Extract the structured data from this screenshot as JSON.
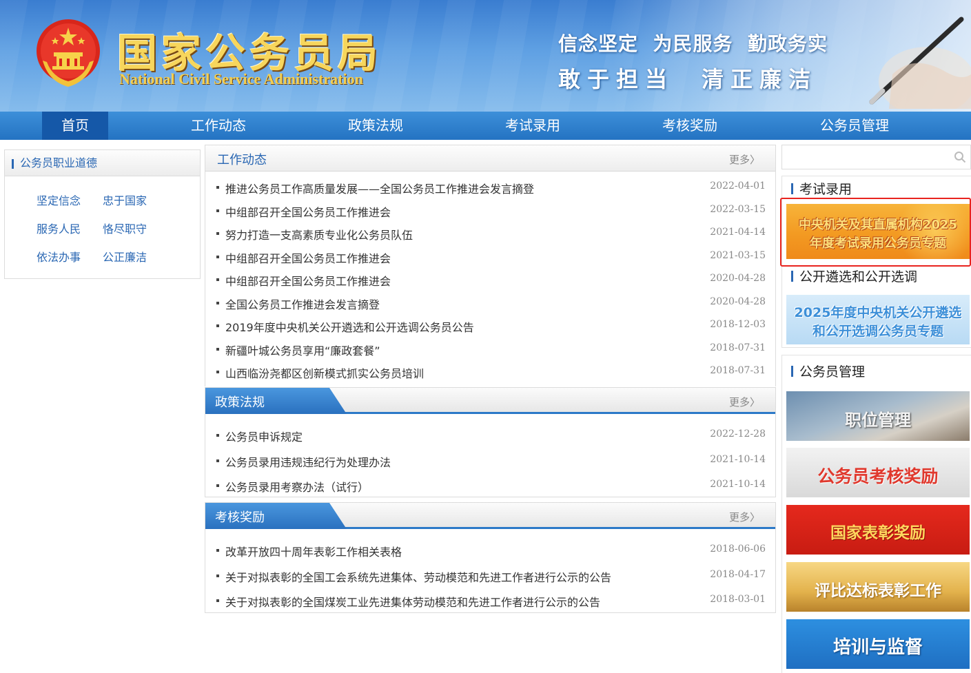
{
  "header": {
    "title_cn": "国家公务员局",
    "title_en": "National Civil Service Administration",
    "slogan_line1": "信念坚定  为民服务  勤政务实",
    "slogan_line2_a": "敢于担当",
    "slogan_line2_b": "清正廉洁"
  },
  "nav": {
    "items": [
      "首页",
      "工作动态",
      "政策法规",
      "考试录用",
      "考核奖励",
      "公务员管理"
    ],
    "active": "首页"
  },
  "left": {
    "title": "公务员职业道德",
    "items": [
      "坚定信念",
      "忠于国家",
      "服务人民",
      "恪尽职守",
      "依法办事",
      "公正廉洁"
    ]
  },
  "panels": {
    "work": {
      "title": "工作动态",
      "more": "更多〉",
      "rows": [
        {
          "text": "推进公务员工作高质量发展——全国公务员工作推进会发言摘登",
          "date": "2022-04-01"
        },
        {
          "text": "中组部召开全国公务员工作推进会",
          "date": "2022-03-15"
        },
        {
          "text": "努力打造一支高素质专业化公务员队伍",
          "date": "2021-04-14"
        },
        {
          "text": "中组部召开全国公务员工作推进会",
          "date": "2021-03-15"
        },
        {
          "text": "中组部召开全国公务员工作推进会",
          "date": "2020-04-28"
        },
        {
          "text": "全国公务员工作推进会发言摘登",
          "date": "2020-04-28"
        },
        {
          "text": "2019年度中央机关公开遴选和公开选调公务员公告",
          "date": "2018-12-03"
        },
        {
          "text": "新疆叶城公务员享用“廉政套餐”",
          "date": "2018-07-31"
        },
        {
          "text": "山西临汾尧都区创新模式抓实公务员培训",
          "date": "2018-07-31"
        }
      ]
    },
    "policy": {
      "title": "政策法规",
      "more": "更多〉",
      "rows": [
        {
          "text": "公务员申诉规定",
          "date": "2022-12-28"
        },
        {
          "text": "公务员录用违规违纪行为处理办法",
          "date": "2021-10-14"
        },
        {
          "text": "公务员录用考察办法（试行）",
          "date": "2021-10-14"
        }
      ]
    },
    "reward": {
      "title": "考核奖励",
      "more": "更多〉",
      "rows": [
        {
          "text": "改革开放四十周年表彰工作相关表格",
          "date": "2018-06-06"
        },
        {
          "text": "关于对拟表彰的全国工会系统先进集体、劳动模范和先进工作者进行公示的公告",
          "date": "2018-04-17"
        },
        {
          "text": "关于对拟表彰的全国煤炭工业先进集体劳动模范和先进工作者进行公示的公告",
          "date": "2018-03-01"
        }
      ]
    }
  },
  "right": {
    "search_placeholder": "",
    "exam_title": "考试录用",
    "exam_banner_line1": "中央机关及其直属机构2025",
    "exam_banner_line2": "年度考试录用公务员专题",
    "select_title": "公开遴选和公开选调",
    "select_banner_line1": "2025年度中央机关公开遴选",
    "select_banner_line2": "和公开选调公务员专题",
    "manage_title": "公务员管理",
    "manage_banners": [
      "职位管理",
      "公务员考核奖励",
      "国家表彰奖励",
      "评比达标表彰工作",
      "培训与监督"
    ]
  },
  "colors": {
    "nav_blue": "#2473c2",
    "nav_active": "#1558a8",
    "link_blue": "#2a67b3",
    "highlight_red": "#e8231e"
  },
  "icons": [
    "national-emblem-icon",
    "search-icon"
  ]
}
